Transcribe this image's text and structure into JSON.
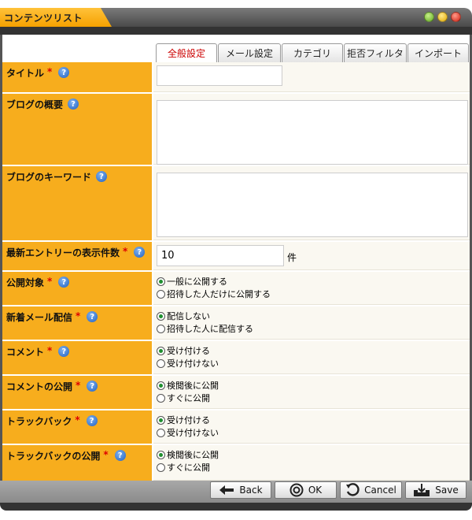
{
  "window": {
    "title": "コンテンツリスト",
    "buttons": [
      "minimize-green",
      "maximize-yellow",
      "close-red"
    ]
  },
  "tabs": [
    {
      "label": "全般設定",
      "active": true
    },
    {
      "label": "メール設定",
      "active": false
    },
    {
      "label": "カテゴリ",
      "active": false
    },
    {
      "label": "拒否フィルタ",
      "active": false
    },
    {
      "label": "インポート",
      "active": false
    }
  ],
  "form": {
    "title": {
      "label": "タイトル",
      "value": ""
    },
    "summary": {
      "label": "ブログの概要",
      "value": ""
    },
    "keywords": {
      "label": "ブログのキーワード",
      "value": ""
    },
    "entry_count": {
      "label": "最新エントリーの表示件数",
      "value": "10",
      "unit": "件"
    },
    "visibility": {
      "label": "公開対象",
      "options": [
        "一般に公開する",
        "招待した人だけに公開する"
      ],
      "selected": 0
    },
    "new_mail": {
      "label": "新着メール配信",
      "options": [
        "配信しない",
        "招待した人に配信する"
      ],
      "selected": 0
    },
    "comment": {
      "label": "コメント",
      "options": [
        "受け付ける",
        "受け付けない"
      ],
      "selected": 0
    },
    "comment_publish": {
      "label": "コメントの公開",
      "options": [
        "検閲後に公開",
        "すぐに公開"
      ],
      "selected": 0
    },
    "trackback": {
      "label": "トラックバック",
      "options": [
        "受け付ける",
        "受け付けない"
      ],
      "selected": 0
    },
    "trackback_publish": {
      "label": "トラックバックの公開",
      "options": [
        "検閲後に公開",
        "すぐに公開"
      ],
      "selected": 0
    }
  },
  "required_mark": "*",
  "help_icon": "question-icon",
  "buttons": {
    "back": "Back",
    "ok": "OK",
    "cancel": "Cancel",
    "save": "Save"
  },
  "colors": {
    "label_bg": "#f7ad1d",
    "accent_red": "#cc0000",
    "radio_selected": "#1f8f2f"
  }
}
